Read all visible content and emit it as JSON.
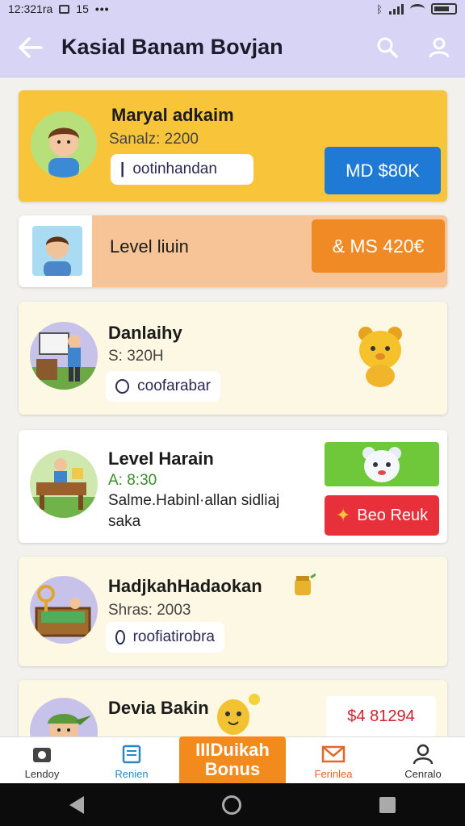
{
  "status_bar": {
    "time": "12:321ra",
    "num": "15"
  },
  "header": {
    "title": "Kasial Banam Bovjan"
  },
  "cards": [
    {
      "name": "Maryal adkaim",
      "sub": "Sanalz: 2200",
      "chip": "ootinhandan",
      "pill": "MD $80K",
      "pill_color": "#1f7ad6"
    },
    {
      "name": "Level liuin",
      "pill": "& MS 420€",
      "pill_color": "#f08a24"
    },
    {
      "name": "Danlaihy",
      "sub": "S: 320H",
      "chip": "coofarabar"
    },
    {
      "name": "Level Harain",
      "sub": "A: 8:30",
      "desc1": "Salme.Habinl·allan sidliaj",
      "desc2": "saka",
      "red_pill": "Beo Reuk",
      "red_color": "#e8303a",
      "green_color": "#6fc73a"
    },
    {
      "name": "HadjkahHadaokan",
      "sub": "Shras: 2003",
      "chip": "roofiatirobra"
    },
    {
      "name": "Devia Bakin",
      "price": "$4 81294",
      "price_color": "#d0202e"
    }
  ],
  "bottom_nav": [
    {
      "label": "Lendoy"
    },
    {
      "label": "Renien"
    },
    {
      "label": "Ferinlea"
    },
    {
      "label": "Cenralo"
    }
  ],
  "bonus": {
    "line1": "IIIDuikah",
    "line2": "Bonus"
  },
  "colors": {
    "accent_yellow": "#f8c53a",
    "header_purple": "#d8d4f6",
    "card_cream": "#fdf8e3",
    "orange": "#f28a1e"
  }
}
